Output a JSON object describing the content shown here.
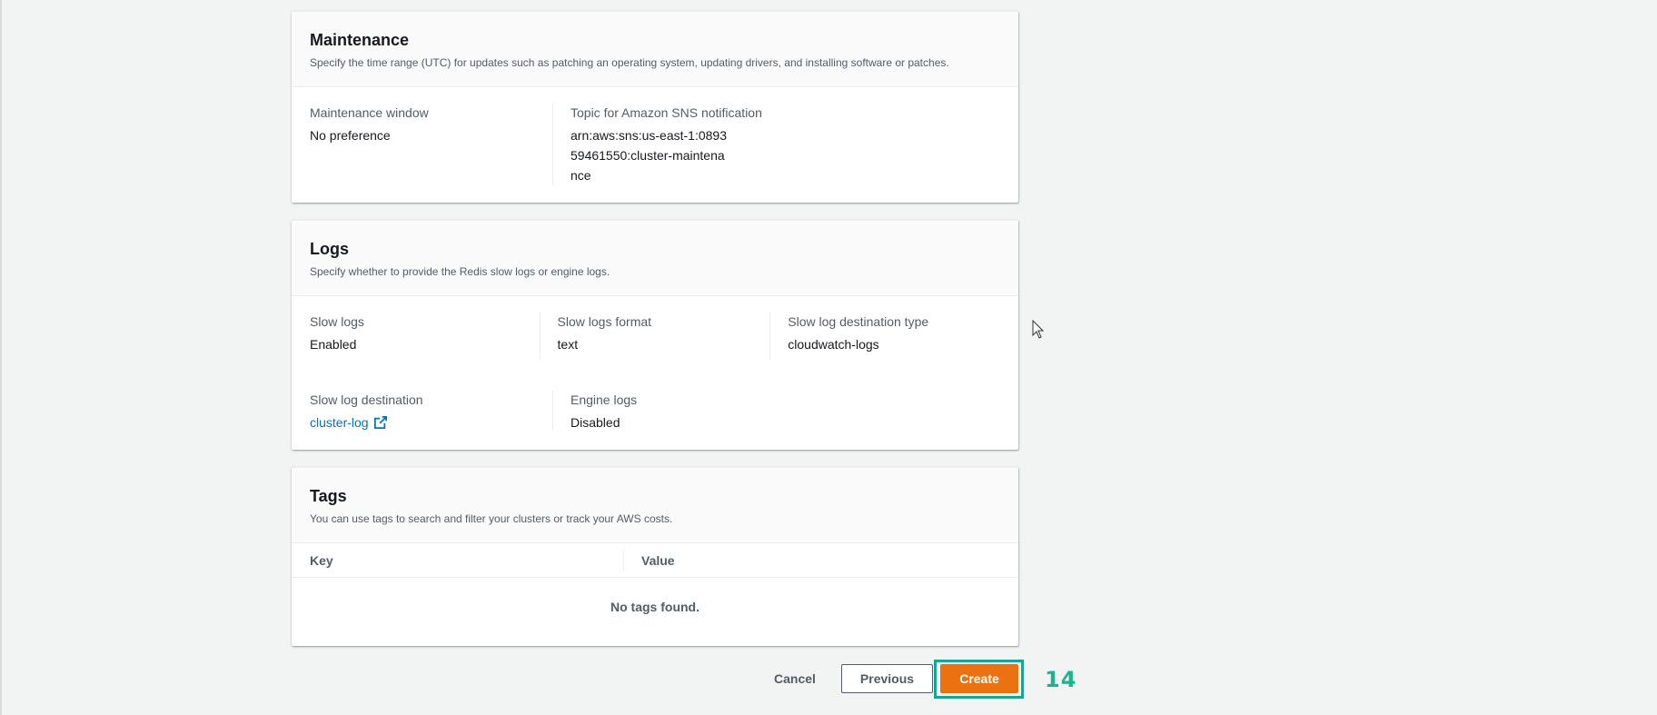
{
  "maintenance": {
    "title": "Maintenance",
    "description": "Specify the time range (UTC) for updates such as patching an operating system, updating drivers, and installing software or patches.",
    "window_label": "Maintenance window",
    "window_value": "No preference",
    "sns_label": "Topic for Amazon SNS notification",
    "sns_value": "arn:aws:sns:us-east-1:089359461550:cluster-maintenance"
  },
  "logs": {
    "title": "Logs",
    "description": "Specify whether to provide the Redis slow logs or engine logs.",
    "slow_logs_label": "Slow logs",
    "slow_logs_value": "Enabled",
    "slow_format_label": "Slow logs format",
    "slow_format_value": "text",
    "dest_type_label": "Slow log destination type",
    "dest_type_value": "cloudwatch-logs",
    "dest_label": "Slow log destination",
    "dest_value": "cluster-log",
    "engine_label": "Engine logs",
    "engine_value": "Disabled"
  },
  "tags": {
    "title": "Tags",
    "description": "You can use tags to search and filter your clusters or track your AWS costs.",
    "columns": [
      "Key",
      "Value"
    ],
    "empty_message": "No tags found."
  },
  "actions": {
    "cancel": "Cancel",
    "previous": "Previous",
    "create": "Create"
  },
  "annotation": {
    "step": "14",
    "color": "#19a593"
  },
  "colors": {
    "primary": "#ec7211",
    "link": "#0073bb"
  }
}
